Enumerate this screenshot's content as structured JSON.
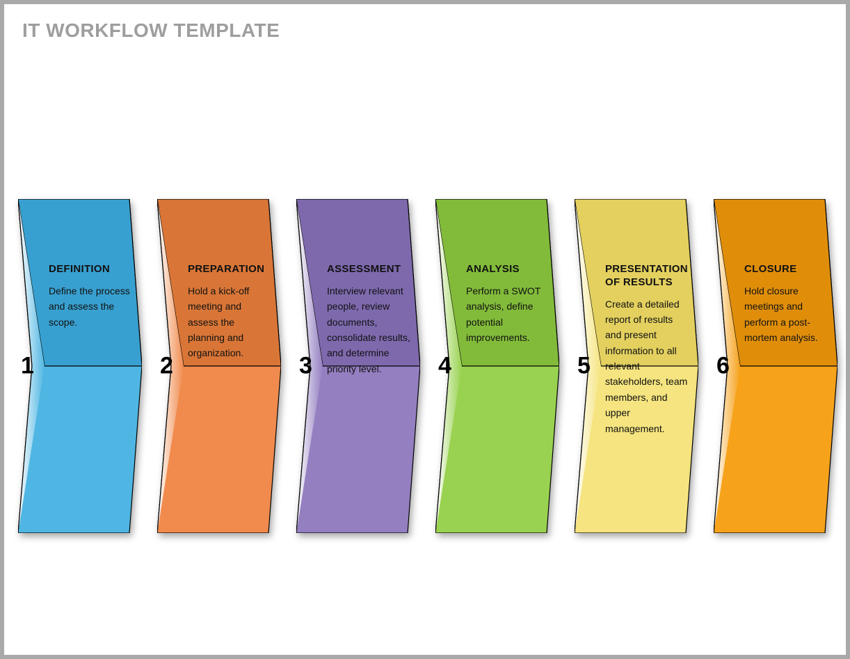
{
  "title": "IT WORKFLOW TEMPLATE",
  "steps": [
    {
      "num": "1",
      "title": "DEFINITION",
      "desc": "Define the process and assess the scope.",
      "fill": "#4fb6e3",
      "fold": "#38a0d0"
    },
    {
      "num": "2",
      "title": "PREPARATION",
      "desc": "Hold a kick-off meeting and assess the planning and organization.",
      "fill": "#f08b4d",
      "fold": "#d97637"
    },
    {
      "num": "3",
      "title": "ASSESSMENT",
      "desc": "Interview relevant people, review documents, consolidate results, and determine priority level.",
      "fill": "#947fc1",
      "fold": "#7e69ad"
    },
    {
      "num": "4",
      "title": "ANALYSIS",
      "desc": "Perform a SWOT analysis, define potential improvements.",
      "fill": "#99d250",
      "fold": "#82bb3a"
    },
    {
      "num": "5",
      "title": "PRESENTATION OF RESULTS",
      "desc": "Create a detailed report of results and present information to all relevant stakeholders, team members, and upper management.",
      "fill": "#f5e47f",
      "fold": "#e3d05f"
    },
    {
      "num": "6",
      "title": "CLOSURE",
      "desc": "Hold closure meetings and perform a post-mortem analysis.",
      "fill": "#f6a21b",
      "fold": "#e08e0a"
    }
  ]
}
